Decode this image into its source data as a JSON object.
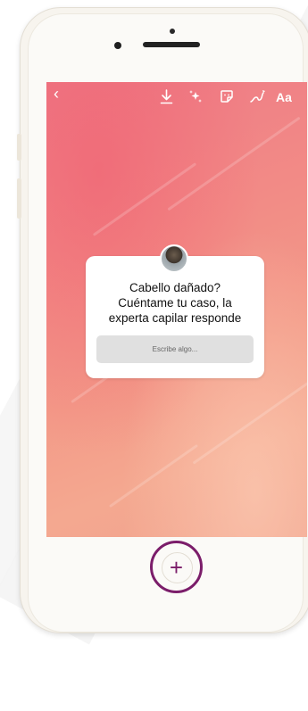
{
  "toolbar": {
    "back_icon": "chevron-left-icon",
    "aa_label": "Aa",
    "icons": [
      "download-icon",
      "effects-icon",
      "sticker-icon",
      "draw-icon"
    ]
  },
  "question_sticker": {
    "question": "Cabello dañado?\nCuéntame tu caso, la\nexperta capilar responde",
    "reply_placeholder": "Escribe algo..."
  },
  "home_button": {
    "label": "+",
    "ring_color": "#7b1d6a"
  }
}
